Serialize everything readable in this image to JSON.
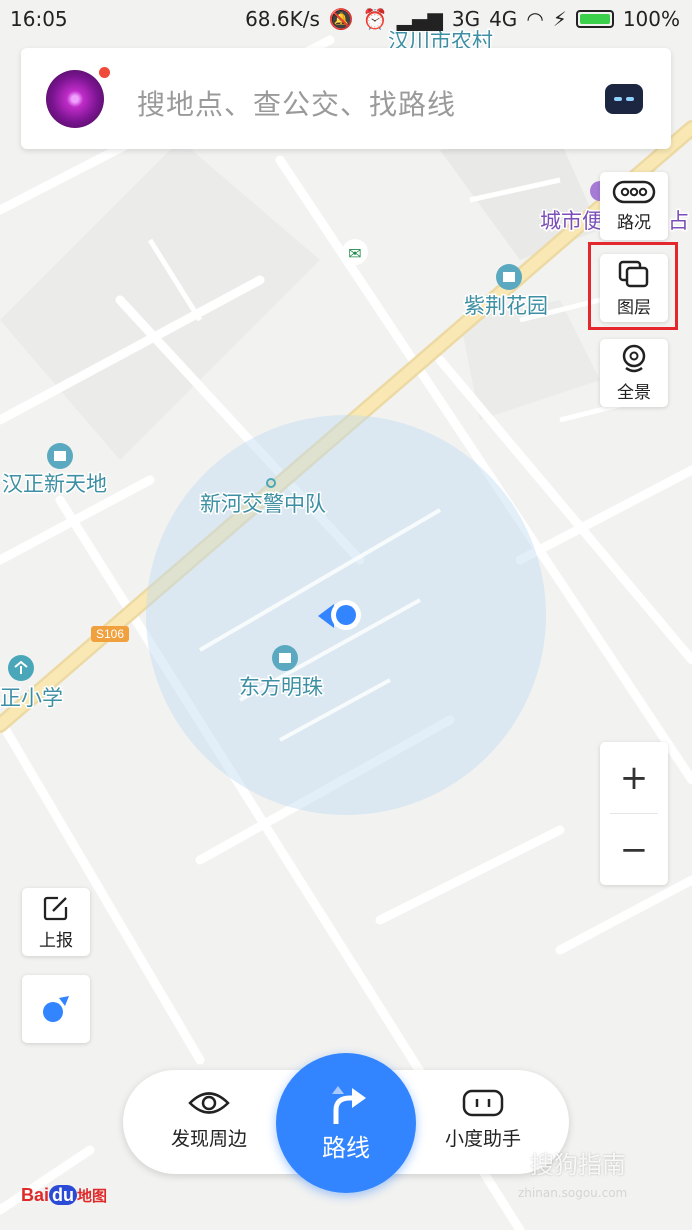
{
  "status_bar": {
    "time": "16:05",
    "speed": "68.6K/s",
    "net1": "3G",
    "net2": "4G",
    "battery": "100%"
  },
  "search": {
    "placeholder": "搜地点、查公交、找路线"
  },
  "tools": {
    "traffic": "路况",
    "layers": "图层",
    "panorama": "全景",
    "report": "上报"
  },
  "map_labels": {
    "top_village": "汉川市农村",
    "city_label": "城市便",
    "city_label_suffix": "占",
    "garden": "紫荆花园",
    "hanzheng": "汉正新天地",
    "police": "新河交警中队",
    "pearl": "东方明珠",
    "school": "正小学",
    "road": "S106"
  },
  "zoom": {
    "in": "+",
    "out": "−"
  },
  "bottom_bar": {
    "discover": "发现周边",
    "route": "路线",
    "assistant": "小度助手"
  },
  "brand": {
    "logo_bai": "Bai",
    "logo_du": "du",
    "logo_map": "地图"
  },
  "watermark": {
    "text": "搜狗指南",
    "url": "zhinan.sogou.com"
  },
  "colors": {
    "accent": "#3385ff",
    "highlight": "#e4262d",
    "road_yellow": "#f7e3a0",
    "poi_teal": "#3d8fa3",
    "poi_purple": "#7b4fb7"
  }
}
